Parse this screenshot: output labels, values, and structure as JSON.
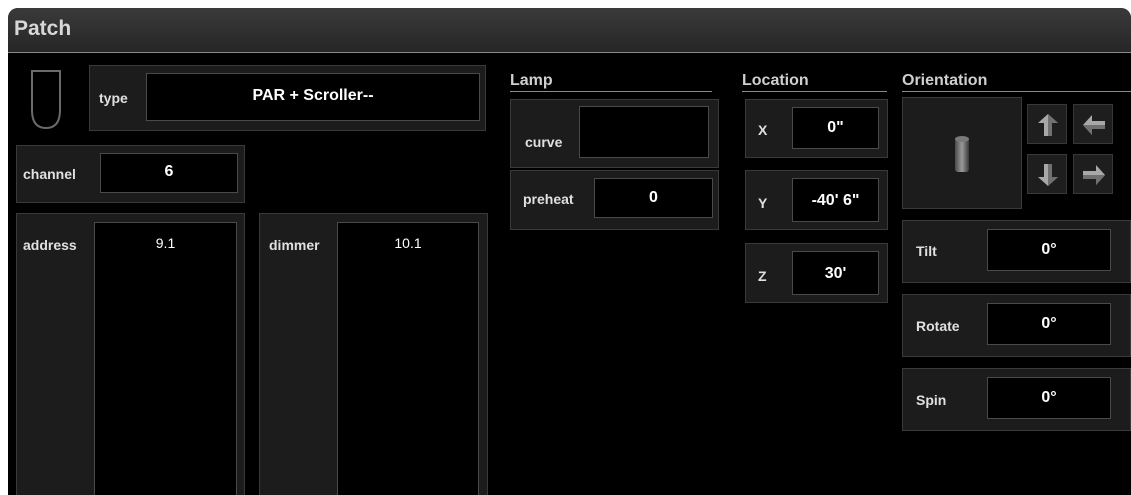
{
  "window": {
    "title": "Patch"
  },
  "type": {
    "label": "type",
    "value": "PAR + Scroller--"
  },
  "channel": {
    "label": "channel",
    "value": "6"
  },
  "address": {
    "label": "address",
    "value": "9.1"
  },
  "dimmer": {
    "label": "dimmer",
    "value": "10.1"
  },
  "lamp": {
    "title": "Lamp",
    "curve": {
      "label": "curve",
      "value": ""
    },
    "preheat": {
      "label": "preheat",
      "value": "0"
    }
  },
  "location": {
    "title": "Location",
    "x": {
      "label": "X",
      "value": "0\""
    },
    "y": {
      "label": "Y",
      "value": "-40' 6\""
    },
    "z": {
      "label": "Z",
      "value": "30'"
    }
  },
  "orientation": {
    "title": "Orientation",
    "tilt": {
      "label": "Tilt",
      "value": "0°"
    },
    "rotate": {
      "label": "Rotate",
      "value": "0°"
    },
    "spin": {
      "label": "Spin",
      "value": "0°"
    },
    "buttons": [
      "tilt-up-icon",
      "rotate-left-icon",
      "tilt-down-icon",
      "rotate-right-icon"
    ]
  },
  "colors": {
    "background": "#000000",
    "panel": "#1c1c1c",
    "text": "#ffffff"
  }
}
